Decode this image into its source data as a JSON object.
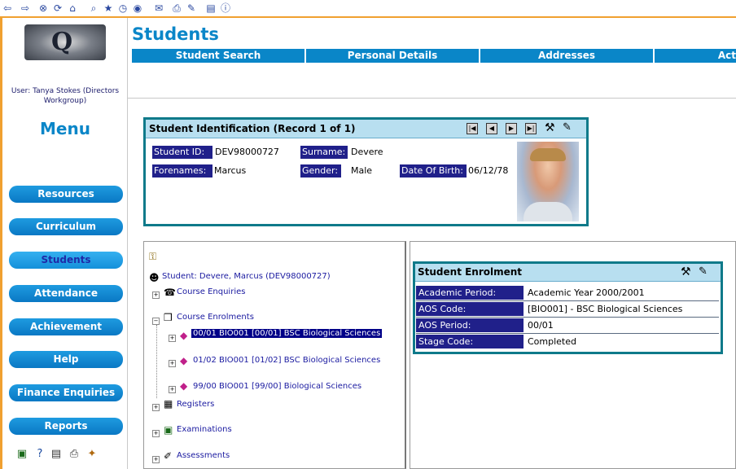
{
  "toolbar": {
    "icons": [
      "back-icon",
      "forward-icon",
      "stop-icon",
      "refresh-icon",
      "home-icon",
      "search-icon",
      "favorites-icon",
      "history-icon",
      "media-icon",
      "mail-icon",
      "print-icon",
      "edit-icon",
      "discuss-icon",
      "info-icon"
    ]
  },
  "sidebar": {
    "user": "User: Tanya Stokes (Directors Workgroup)",
    "menu_title": "Menu",
    "nav": [
      {
        "label": "Resources"
      },
      {
        "label": "Curriculum"
      },
      {
        "label": "Students",
        "active": true
      },
      {
        "label": "Attendance"
      },
      {
        "label": "Achievement"
      },
      {
        "label": "Help"
      },
      {
        "label": "Finance Enquiries"
      },
      {
        "label": "Reports"
      }
    ]
  },
  "header": {
    "title": "Students",
    "tabs": [
      {
        "label": "Student Search"
      },
      {
        "label": "Personal Details"
      },
      {
        "label": "Addresses"
      },
      {
        "label": "Act"
      }
    ]
  },
  "student_id_panel": {
    "title": "Student Identification (Record 1 of 1)",
    "student_id_label": "Student ID:",
    "student_id": "DEV98000727",
    "surname_label": "Surname:",
    "surname": "Devere",
    "forenames_label": "Forenames:",
    "forenames": "Marcus",
    "gender_label": "Gender:",
    "gender": "Male",
    "dob_label": "Date Of Birth:",
    "dob": "06/12/78"
  },
  "tree": {
    "root": "Student: Devere, Marcus (DEV98000727)",
    "course_enquiries": "Course Enquiries",
    "course_enrolments": "Course Enrolments",
    "enrolments": [
      {
        "label": "00/01 BIO001 [00/01] BSC Biological Sciences",
        "selected": true
      },
      {
        "label": "01/02 BIO001 [01/02] BSC Biological Sciences"
      },
      {
        "label": "99/00 BIO001 [99/00] Biological Sciences"
      }
    ],
    "registers": "Registers",
    "examinations": "Examinations",
    "assessments": "Assessments"
  },
  "enrolment_panel": {
    "title": "Student Enrolment",
    "rows": [
      {
        "label": "Academic Period:",
        "value": "Academic Year 2000/2001"
      },
      {
        "label": "AOS Code:",
        "value": "[BIO001] - BSC Biological Sciences"
      },
      {
        "label": "AOS Period:",
        "value": "00/01"
      },
      {
        "label": "Stage Code:",
        "value": "Completed"
      }
    ]
  }
}
